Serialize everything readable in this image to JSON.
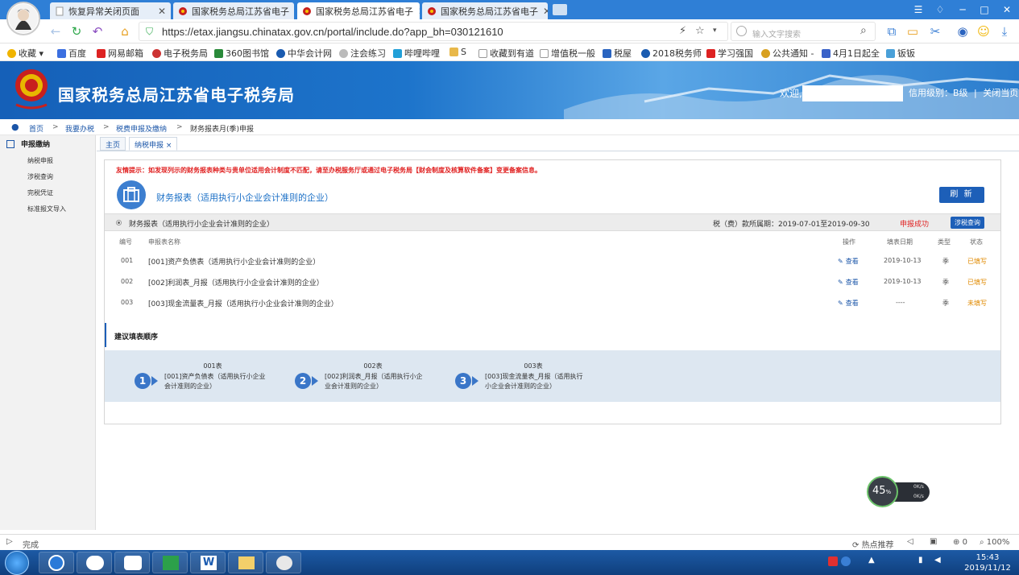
{
  "browser": {
    "tabs": [
      {
        "label": "恢复异常关闭页面",
        "active": false
      },
      {
        "label": "国家税务总局江苏省电子",
        "active": false
      },
      {
        "label": "国家税务总局江苏省电子",
        "active": true
      },
      {
        "label": "国家税务总局江苏省电子",
        "active": false
      }
    ],
    "url": "https://etax.jiangsu.chinatax.gov.cn/portal/include.do?app_bh=030121610",
    "search_placeholder": "输入文字搜索",
    "bookmarks": [
      {
        "label": "收藏",
        "color": "#f0b400"
      },
      {
        "label": "百度",
        "color": "#3b6fe0"
      },
      {
        "label": "网易邮箱",
        "color": "#d22"
      },
      {
        "label": "电子税务局",
        "color": "#c33"
      },
      {
        "label": "360图书馆",
        "color": "#2a8a3a"
      },
      {
        "label": "中华会计网",
        "color": "#1a5bb0"
      },
      {
        "label": "注会练习",
        "color": "#666"
      },
      {
        "label": "哔哩哔哩",
        "color": "#22a0d8"
      },
      {
        "label": "S",
        "color": "#e8b84a"
      },
      {
        "label": "收藏到有道",
        "color": "#888"
      },
      {
        "label": "增值税一般",
        "color": "#888"
      },
      {
        "label": "税屋",
        "color": "#2a64c0"
      },
      {
        "label": "2018税务师",
        "color": "#1a5bb0"
      },
      {
        "label": "学习强国",
        "color": "#d22"
      },
      {
        "label": "公共通知 -",
        "color": "#d8a020"
      },
      {
        "label": "4月1日起全",
        "color": "#3a62c8"
      },
      {
        "label": "钣钣",
        "color": "#4aa0d8"
      }
    ],
    "status_text": "完成",
    "status_right": {
      "hot": "热点推荐",
      "count": "0",
      "zoom": "100%"
    }
  },
  "site": {
    "title": "国家税务总局江苏省电子税务局",
    "welcome": "欢迎,",
    "credit": "信用级别：B级",
    "sep": "|",
    "close": "关闭当页"
  },
  "breadcrumb": [
    "首页",
    "我要办税",
    "税费申报及缴纳",
    "财务报表月(季)申报"
  ],
  "sidebar": {
    "title": "申报缴纳",
    "items": [
      "纳税申报",
      "涉税查询",
      "完税凭证",
      "标准报文导入"
    ]
  },
  "page_tabs": [
    {
      "label": "主页"
    },
    {
      "label": "纳税申报 ×"
    }
  ],
  "panel": {
    "tip": "友情提示：如发现列示的财务报表种类与贵单位适用会计制度不匹配，请至办税服务厅或通过电子税务局【财会制度及核算软件备案】变更备案信息。",
    "form_title": "财务报表（适用执行小企业会计准则的企业）",
    "refresh": "刷 新",
    "period": {
      "name": "财务报表（适用执行小企业会计准则的企业）",
      "date": "税（费）款所属期：2019-07-01至2019-09-30",
      "status": "申报成功",
      "audit_button": "涉税查询"
    },
    "columns": [
      "编号",
      "申报表名称",
      "操作",
      "填表日期",
      "类型",
      "状态"
    ],
    "rows": [
      {
        "no": "001",
        "name": "[001]资产负债表（适用执行小企业会计准则的企业）",
        "action": "查看",
        "date": "2019-10-13",
        "type": "季",
        "status": "已填写",
        "status_color": "#e08a00"
      },
      {
        "no": "002",
        "name": "[002]利润表_月报（适用执行小企业会计准则的企业）",
        "action": "查看",
        "date": "2019-10-13",
        "type": "季",
        "status": "已填写",
        "status_color": "#e08a00"
      },
      {
        "no": "003",
        "name": "[003]现金流量表_月报（适用执行小企业会计准则的企业）",
        "action": "查看",
        "date": "----",
        "type": "季",
        "status": "未填写",
        "status_color": "#e08a00"
      }
    ],
    "suggest_title": "建议填表顺序",
    "steps": [
      {
        "num": "1",
        "title": "001表",
        "desc": "[001]资产负债表（适用执行小企业会计准则的企业）"
      },
      {
        "num": "2",
        "title": "002表",
        "desc": "[002]利润表_月报（适用执行小企业会计准则的企业）"
      },
      {
        "num": "3",
        "title": "003表",
        "desc": "[003]现金流量表_月报（适用执行小企业会计准则的企业）"
      }
    ]
  },
  "speed_widget": {
    "value": "45",
    "unit": "%",
    "up": "0K/s",
    "down": "0K/s"
  },
  "taskbar": {
    "time": "15:43",
    "date": "2019/11/12"
  }
}
